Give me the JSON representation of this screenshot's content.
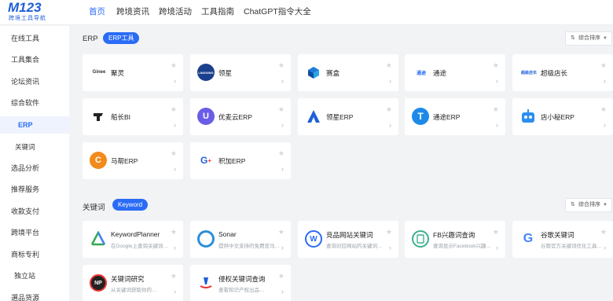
{
  "logo": {
    "main": "M123",
    "sub": "跨境工具导航"
  },
  "nav": [
    {
      "label": "首页",
      "active": true
    },
    {
      "label": "跨境资讯"
    },
    {
      "label": "跨境活动"
    },
    {
      "label": "工具指南"
    },
    {
      "label": "ChatGPT指令大全"
    }
  ],
  "sidebar": [
    "在线工具",
    "工具集合",
    "论坛资讯",
    "综合软件",
    "ERP",
    "关键词",
    "选品分析",
    "推荐服务",
    "收款支付",
    "跨境平台",
    "商标专利",
    "独立站",
    "選品货源"
  ],
  "sections": {
    "erp": {
      "title": "ERP",
      "pill": "ERP工具",
      "sort": "综合排序"
    },
    "keyword": {
      "title": "关键词",
      "pill": "Keyword",
      "sort": "综合排序"
    }
  },
  "erp_cards": [
    {
      "name": "聚灵",
      "icon": "Ginee"
    },
    {
      "name": "领星",
      "icon": "LINGXING"
    },
    {
      "name": "赛盒",
      "icon": ""
    },
    {
      "name": "通途",
      "icon": "通途"
    },
    {
      "name": "超级店长",
      "icon": "超级店长"
    },
    {
      "name": "船长BI",
      "icon": ""
    },
    {
      "name": "优麦云ERP",
      "icon": ""
    },
    {
      "name": "领星ERP",
      "icon": ""
    },
    {
      "name": "通途ERP",
      "icon": ""
    },
    {
      "name": "店小秘ERP",
      "icon": ""
    },
    {
      "name": "马帮ERP",
      "icon": ""
    },
    {
      "name": "积加ERP",
      "icon": ""
    }
  ],
  "keyword_cards": [
    {
      "name": "KeywordPlanner",
      "desc": "在Google上查询关键词…"
    },
    {
      "name": "Sonar",
      "desc": "提供中文支持的免费亚马逊…"
    },
    {
      "name": "竞品网站关键词",
      "desc": "查询对应网站的关键词…"
    },
    {
      "name": "FB兴趣词查询",
      "desc": "查询显示Facebook兴趣词…"
    },
    {
      "name": "谷歌关键词",
      "desc": "谷歌官方关键词优化工具…"
    },
    {
      "name": "关键词研究",
      "desc": "从关键词获取你的…"
    },
    {
      "name": "侵权关键词查询",
      "desc": "查看知识产权出品…"
    }
  ],
  "icons": {
    "star": "star-icon",
    "arrow": "chevron-right-icon",
    "sort": "sort-icon",
    "sort_caret": "caret-down-icon"
  },
  "colors": {
    "accent": "#2b6cf6",
    "background": "#f2f3f5",
    "card": "#ffffff"
  }
}
